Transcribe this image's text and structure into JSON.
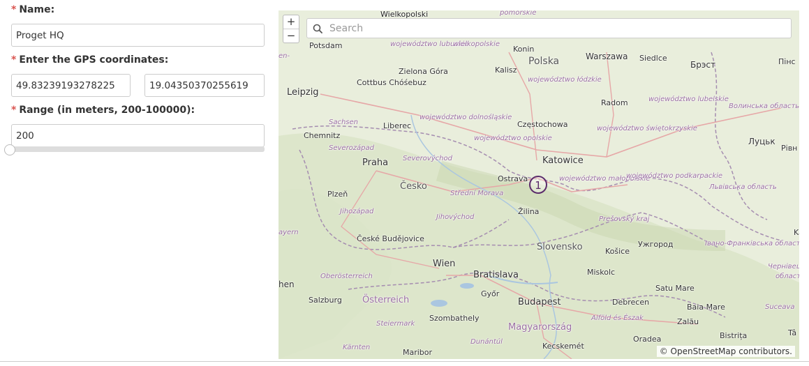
{
  "form": {
    "name_label": "Name:",
    "name_value": "Proget HQ",
    "gps_label": "Enter the GPS coordinates:",
    "latitude_value": "49.83239193278225",
    "longitude_value": "19.04350370255619",
    "range_label": "Range (in meters, 200-100000):",
    "range_value": "200",
    "range_min": 200,
    "range_max": 100000,
    "required_marker": "*"
  },
  "map": {
    "search_placeholder": "Search",
    "zoom_in_label": "+",
    "zoom_out_label": "−",
    "marker_label": "1",
    "attribution_symbol": "©",
    "attribution_link": "OpenStreetMap",
    "attribution_suffix": "contributors.",
    "place_labels": [
      "Wielkopolski",
      "pomorskie",
      "Potsdam",
      "województwo lubuskie",
      "wielkopolskie",
      "Konin",
      "Warszawa",
      "Siedlce",
      "Брэст",
      "Пінс",
      "en-",
      "Zielona Góra",
      "Cottbus Chóśebuz",
      "Polska",
      "Kalisz",
      "województwo łódzkie",
      "Leipzig",
      "Radom",
      "województwo lubelskie",
      "Волинська область",
      "Sachsen",
      "Liberec",
      "województwo dolnośląskie",
      "Częstochowa",
      "Chemnitz",
      "województwo opolskie",
      "województwo świętokrzyskie",
      "Луцьк",
      "Рівн",
      "Severozápad",
      "Severovýchod",
      "Katowice",
      "Praha",
      "Ostrava",
      "województwo małopolskie",
      "województwo podkarpackie",
      "Česko",
      "Střední Morava",
      "Львівська область",
      "Plzeň",
      "Žilina",
      "Jihozápad",
      "Jihovýchod",
      "Prešovský kraj",
      "Kam",
      "ayern",
      "České Budějovice",
      "Slovensko",
      "Košice",
      "Ужгород",
      "Івано-Франківська область",
      "Wien",
      "Bratislava",
      "Miskolc",
      "Чернівецьк",
      "область",
      "hen",
      "Oberösterreich",
      "Győr",
      "Satu Mare",
      "Salzburg",
      "Österreich",
      "Budapest",
      "Debrecen",
      "Baia Mare",
      "Suceava",
      "Szombathely",
      "Alföld és Észak",
      "Zalău",
      "Steiermark",
      "Magyarország",
      "Tâ",
      "Dunántúl",
      "Oradea",
      "Bistrița",
      "Kärnten",
      "Maribor",
      "Kecskemét"
    ]
  }
}
